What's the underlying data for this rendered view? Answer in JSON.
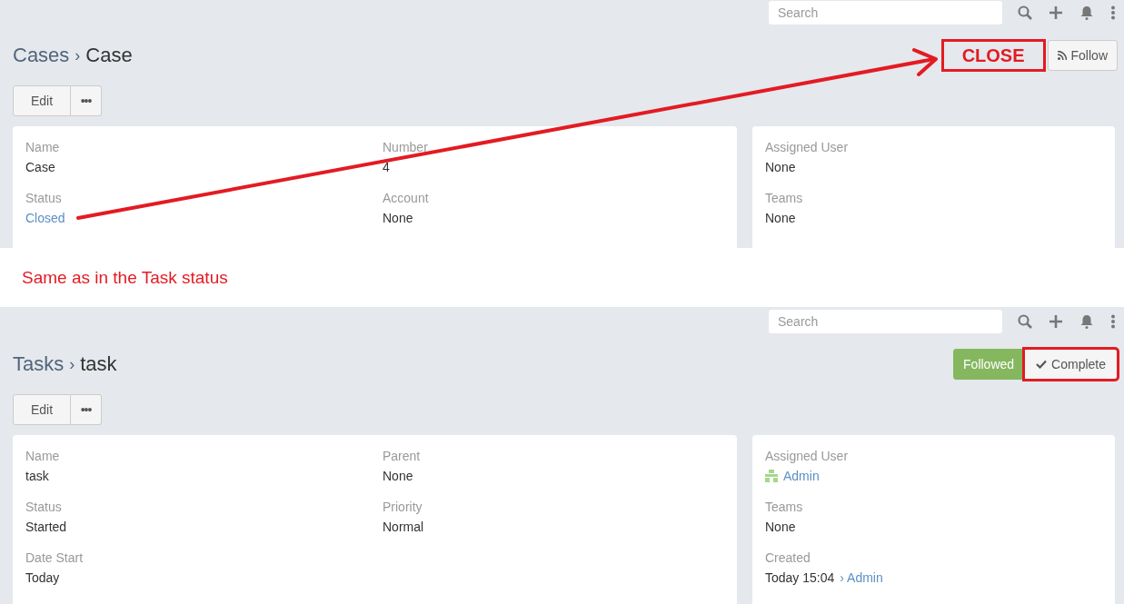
{
  "panels": [
    {
      "search": {
        "placeholder": "Search"
      },
      "breadcrumb": {
        "parent": "Cases",
        "separator": "›",
        "current": "Case"
      },
      "actions": [
        {
          "kind": "callout",
          "label": "CLOSE",
          "highlighted": true
        },
        {
          "kind": "follow",
          "label": "Follow",
          "highlighted": false
        }
      ],
      "edit": {
        "label": "Edit",
        "more": "•••"
      },
      "main_fields": [
        {
          "label": "Name",
          "value": "Case",
          "link": false
        },
        {
          "label": "Number",
          "value": "4",
          "link": false
        },
        {
          "label": "Status",
          "value": "Closed",
          "link": true
        },
        {
          "label": "Account",
          "value": "None",
          "link": false
        }
      ],
      "side_fields": [
        {
          "label": "Assigned User",
          "value": "None",
          "link": false
        },
        {
          "label": "Teams",
          "value": "None",
          "link": false
        }
      ]
    },
    {
      "search": {
        "placeholder": "Search"
      },
      "breadcrumb": {
        "parent": "Tasks",
        "separator": "›",
        "current": "task"
      },
      "actions": [
        {
          "kind": "followed",
          "label": "Followed",
          "highlighted": false
        },
        {
          "kind": "complete",
          "label": "Complete",
          "highlighted": true
        }
      ],
      "edit": {
        "label": "Edit",
        "more": "•••"
      },
      "main_fields": [
        {
          "label": "Name",
          "value": "task",
          "link": false
        },
        {
          "label": "Parent",
          "value": "None",
          "link": false
        },
        {
          "label": "Status",
          "value": "Started",
          "link": false
        },
        {
          "label": "Priority",
          "value": "Normal",
          "link": false
        },
        {
          "label": "Date Start",
          "value": "Today",
          "link": false
        }
      ],
      "side_fields": [
        {
          "label": "Assigned User",
          "value": "Admin",
          "link": true,
          "avatar": true
        },
        {
          "label": "Teams",
          "value": "None",
          "link": false
        },
        {
          "label": "Created",
          "value": "Today 15:04",
          "link": false,
          "by": "› Admin"
        }
      ]
    }
  ],
  "annotation": "Same as in the Task status"
}
